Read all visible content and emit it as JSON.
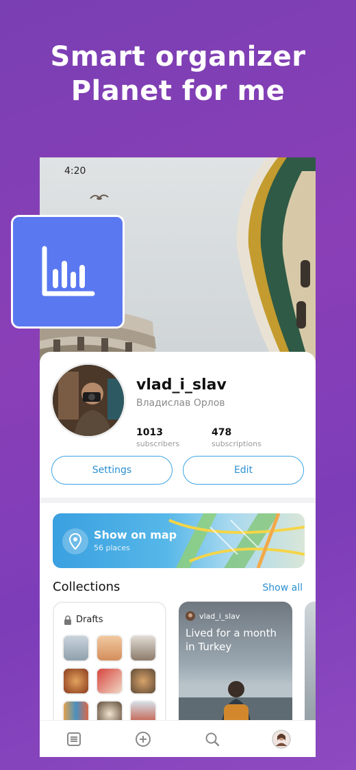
{
  "headline": {
    "line1": "Smart organizer",
    "line2": "Planet for me"
  },
  "status_bar": {
    "time": "4:20"
  },
  "profile": {
    "username": "vlad_i_slav",
    "full_name": "Владислав Орлов",
    "subscribers_count": "1013",
    "subscribers_label": "subscribers",
    "subscriptions_count": "478",
    "subscriptions_label": "subscriptions",
    "settings_label": "Settings",
    "edit_label": "Edit"
  },
  "map_banner": {
    "title": "Show on map",
    "subtitle": "56 places",
    "icon": "map-pin-icon"
  },
  "collections": {
    "title": "Collections",
    "show_all_label": "Show all",
    "drafts": {
      "label": "Drafts",
      "icon": "lock-icon"
    },
    "featured": {
      "author": "vlad_i_slav",
      "title": "Lived for a month in Turkey"
    }
  },
  "tabbar": {
    "items": [
      "feed-icon",
      "add-icon",
      "search-icon",
      "profile-avatar"
    ]
  },
  "colors": {
    "background": "#8a3fb7",
    "accent": "#2a8fd0",
    "app_icon_bg": "#5a78f0"
  }
}
